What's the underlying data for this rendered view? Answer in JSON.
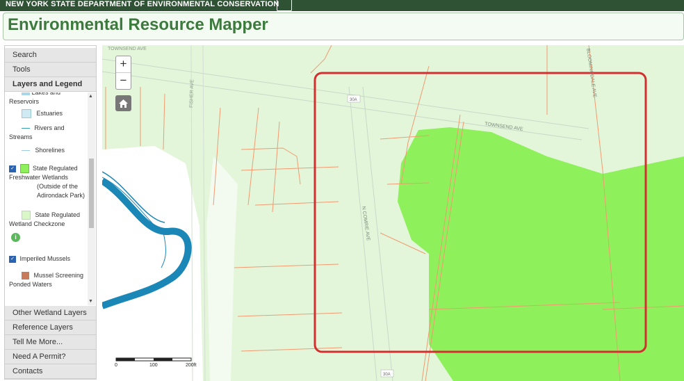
{
  "header": {
    "agency": "NEW YORK STATE DEPARTMENT OF ENVIRONMENTAL CONSERVATION",
    "app_title": "Environmental Resource Mapper"
  },
  "sidebar": {
    "sections_top": [
      "Search",
      "Tools",
      "Layers and Legend"
    ],
    "legend_items": [
      {
        "label": "Lakes and Reservoirs",
        "color": "#a9d6ea"
      },
      {
        "label": "Estuaries",
        "color": "#cfeaf3"
      },
      {
        "label": "Rivers and Streams",
        "color": "#3a9bb5"
      },
      {
        "label": "Shorelines",
        "color": "#9ccbe0"
      },
      {
        "label": "State Regulated Freshwater Wetlands",
        "sublabel": "(Outside of the Adirondack Park)",
        "color": "#8ef05a",
        "checked": true
      },
      {
        "label": "State Regulated Wetland Checkzone",
        "color": "#d9f7c8"
      },
      {
        "label": "Imperiled Mussels",
        "checked": true
      },
      {
        "label": "Mussel Screening Ponded Waters",
        "color": "#c97a5a"
      }
    ],
    "sections_bottom": [
      "Other Wetland Layers",
      "Reference Layers",
      "Tell Me More...",
      "Need A Permit?",
      "Contacts"
    ]
  },
  "map": {
    "zoom_in": "+",
    "zoom_out": "−",
    "home_icon": "home-icon",
    "street_labels": {
      "townsend_top": "TOWNSEND AVE",
      "townsend": "TOWNSEND AVE",
      "bloomingdale": "BLOOMINGDALE AVE",
      "fisher": "FISHER AVE",
      "n_comrie": "N COMRIE AVE",
      "route_30a_top": "30A",
      "route_30a_bottom": "30A"
    },
    "scale": {
      "labels": [
        "0",
        "100",
        "200ft"
      ]
    },
    "colors": {
      "wetland": "#8ef05a",
      "checkzone": "#e3f6da",
      "parcel_line": "#f29a70",
      "stream": "#1b87b6",
      "highlight": "#d23030"
    }
  }
}
